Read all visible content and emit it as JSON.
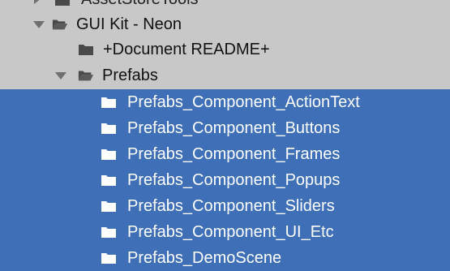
{
  "tree": {
    "top_partial_label": "AssetStoreTools",
    "root": {
      "label": "GUI Kit - Neon",
      "expanded": true
    },
    "document": {
      "label": "+Document README+"
    },
    "prefabs": {
      "label": "Prefabs",
      "expanded": true
    },
    "children": [
      {
        "label": "Prefabs_Component_ActionText",
        "selected": true
      },
      {
        "label": "Prefabs_Component_Buttons",
        "selected": true
      },
      {
        "label": "Prefabs_Component_Frames",
        "selected": true
      },
      {
        "label": "Prefabs_Component_Popups",
        "selected": true
      },
      {
        "label": "Prefabs_Component_Sliders",
        "selected": true
      },
      {
        "label": "Prefabs_Component_UI_Etc",
        "selected": true
      },
      {
        "label": "Prefabs_DemoScene",
        "selected": true
      }
    ]
  },
  "colors": {
    "background": "#c8c8c8",
    "selected": "#3e6fb7",
    "text": "#111111",
    "selected_text": "#ffffff",
    "folder": "#4a4a4a",
    "arrow": "#6f6f6f"
  },
  "icons": {
    "collapse": "chevron-down-icon",
    "expand": "chevron-right-icon",
    "folder_open": "open-folder-icon",
    "folder": "folder-icon"
  }
}
